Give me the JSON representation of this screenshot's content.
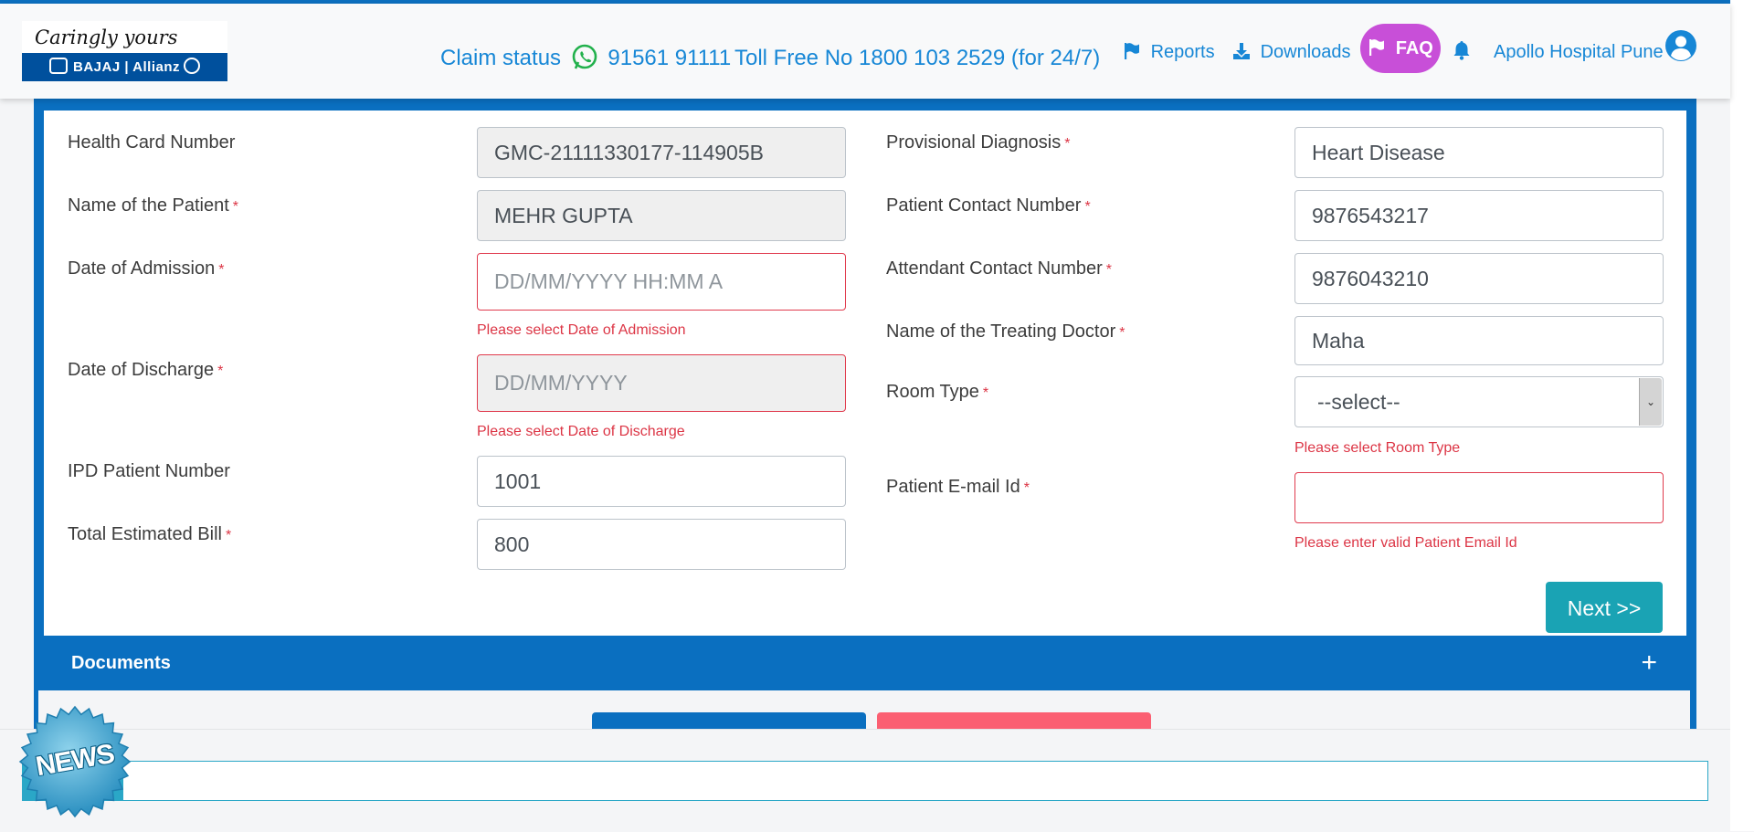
{
  "header": {
    "logo_tagline": "Caringly yours",
    "logo_brand": "BAJAJ",
    "logo_brand2": "Allianz",
    "claim_status_label": "Claim status",
    "whatsapp_number": "91561 91111",
    "toll_free": "Toll Free No 1800 103 2529 (for 24/7)",
    "nav": {
      "reports": "Reports",
      "downloads": "Downloads",
      "faq": "FAQ"
    },
    "user_name": "Apollo Hospital Pune",
    "colors": {
      "link": "#1787d6",
      "faq_bg": "#c84fd8",
      "brand_blue": "#00509d"
    }
  },
  "form": {
    "left": {
      "health_card": {
        "label": "Health Card Number",
        "value": "GMC-21111330177-114905B"
      },
      "patient_name": {
        "label": "Name of the Patient",
        "value": "MEHR GUPTA"
      },
      "admission": {
        "label": "Date of Admission",
        "placeholder": "DD/MM/YYYY HH:MM A",
        "error": "Please select Date of Admission"
      },
      "discharge": {
        "label": "Date of Discharge",
        "placeholder": "DD/MM/YYYY",
        "error": "Please select Date of Discharge"
      },
      "ipd": {
        "label": "IPD Patient Number",
        "value": "1001"
      },
      "bill": {
        "label": "Total Estimated Bill",
        "value": "800"
      }
    },
    "right": {
      "diagnosis": {
        "label": "Provisional Diagnosis",
        "value": "Heart Disease"
      },
      "contact": {
        "label": "Patient Contact Number",
        "value": "9876543217"
      },
      "attendant": {
        "label": "Attendant Contact Number",
        "value": "9876043210"
      },
      "doctor": {
        "label": "Name of the Treating Doctor",
        "value": "Maha"
      },
      "room": {
        "label": "Room Type",
        "selected": "--select--",
        "error": "Please select Room Type"
      },
      "email": {
        "label": "Patient E-mail Id",
        "value": "",
        "error": "Please enter valid Patient Email Id"
      }
    },
    "required_mark": "*",
    "next_label": "Next >>"
  },
  "documents": {
    "title": "Documents",
    "toggle": "+"
  },
  "news": {
    "badge": "NEWS"
  },
  "colors": {
    "panel_blue": "#0a6fc0",
    "error": "#dc3545",
    "next_btn": "#1aa3b4",
    "ticker": "#2aa7c7"
  }
}
